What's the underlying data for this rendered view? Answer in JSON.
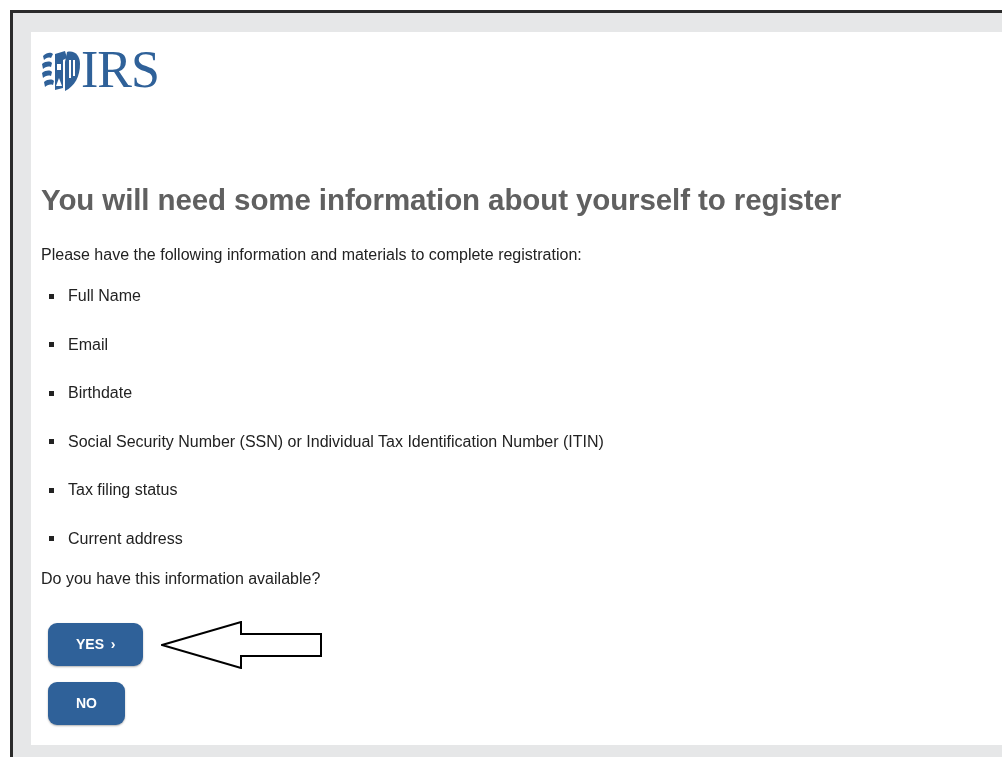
{
  "logo": {
    "text": "IRS"
  },
  "heading": "You will need some information about yourself to register",
  "intro": "Please have the following information and materials to complete registration:",
  "items": [
    "Full Name",
    "Email",
    "Birthdate",
    "Social Security Number (SSN) or Individual Tax Identification Number (ITIN)",
    "Tax filing status",
    "Current address"
  ],
  "question": "Do you have this information available?",
  "buttons": [
    {
      "label": "YES",
      "suffix": "›",
      "pointed": true
    },
    {
      "label": "NO",
      "pointed": false
    }
  ]
}
